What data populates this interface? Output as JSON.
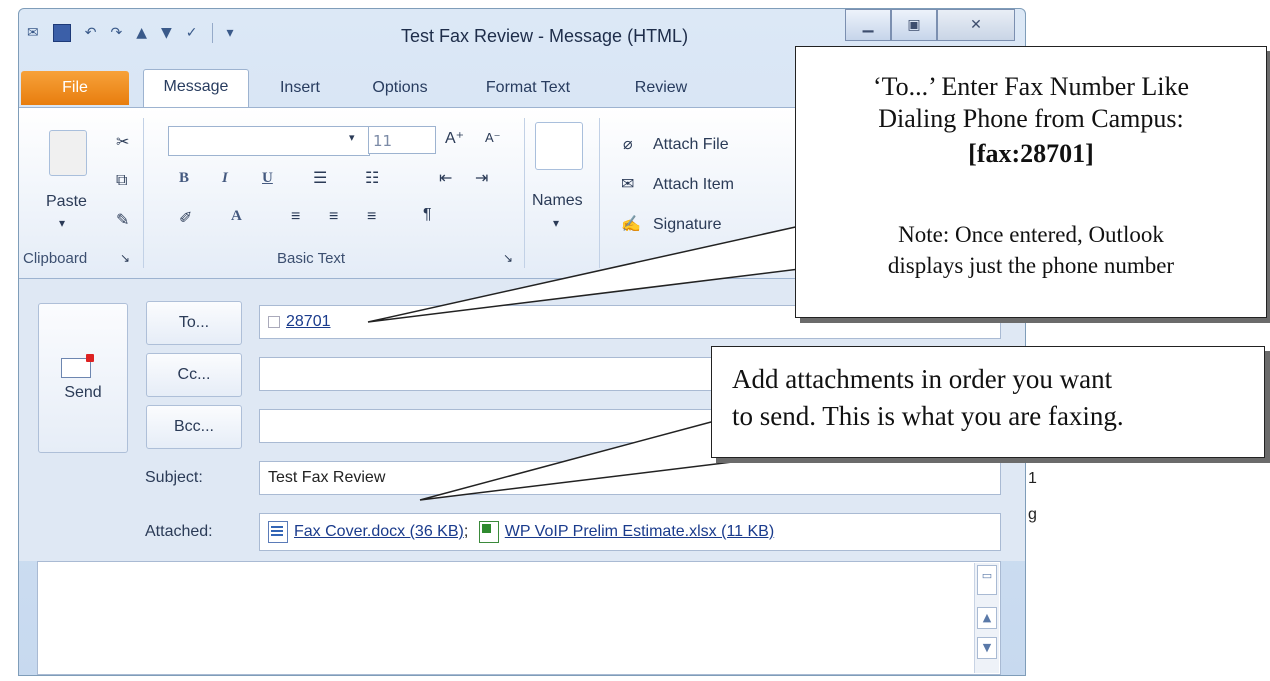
{
  "window": {
    "title": "Test Fax Review - Message (HTML)",
    "controls": [
      "minimize",
      "maximize",
      "close"
    ]
  },
  "ribbon": {
    "tabs": [
      "File",
      "Message",
      "Insert",
      "Options",
      "Format Text",
      "Review"
    ],
    "active_tab": "Message",
    "clipboard": {
      "paste_label": "Paste",
      "group_label": "Clipboard"
    },
    "basic_text": {
      "font_size": "11",
      "group_label": "Basic Text"
    },
    "names": {
      "label": "Names"
    },
    "include": {
      "attach_file": "Attach File",
      "attach_item": "Attach Item",
      "signature": "Signature"
    }
  },
  "compose": {
    "send_label": "Send",
    "to_button": "To...",
    "cc_button": "Cc...",
    "bcc_button": "Bcc...",
    "to_value": "28701",
    "cc_value": "",
    "bcc_value": "",
    "subject_label": "Subject:",
    "subject_value": "Test Fax Review",
    "attached_label": "Attached:",
    "attachments": [
      {
        "name": "Fax Cover.docx (36 KB)",
        "type": "word",
        "separator": ";"
      },
      {
        "name": "WP VoIP Prelim Estimate.xlsx (11 KB)",
        "type": "excel",
        "separator": ""
      }
    ]
  },
  "callouts": {
    "to_note": {
      "line1": "‘To...’ Enter Fax Number Like",
      "line2": "Dialing Phone from Campus:",
      "line3": "[fax:28701]",
      "note1": "Note:  Once entered, Outlook",
      "note2": "displays just the phone number"
    },
    "attach_note": {
      "line1": "Add attachments in order you want",
      "line2": "to send.  This is what you are faxing."
    }
  },
  "fragments": {
    "f1": "1",
    "f2": "g"
  },
  "colors": {
    "file_tab": "#e87d0e",
    "link": "#1a3b8c",
    "frame": "#c7d9ef"
  }
}
